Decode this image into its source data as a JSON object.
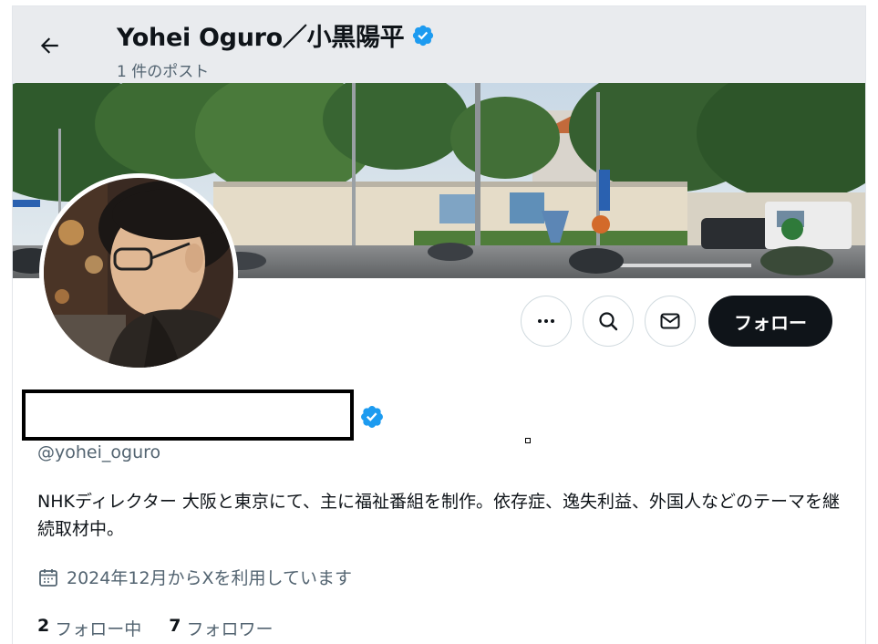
{
  "header": {
    "display_name": "Yohei Oguro／小黒陽平",
    "post_count": "1 件のポスト",
    "back_icon": "arrow-left-icon",
    "verified_icon": "verified-badge-icon"
  },
  "profile": {
    "handle": "@yohei_oguro",
    "bio": "NHKディレクター 大阪と東京にて、主に福祉番組を制作。依存症、逸失利益、外国人などのテーマを継続取材中。",
    "joined": "2024年12月からXを利用しています",
    "calendar_icon": "calendar-icon"
  },
  "actions": {
    "more_icon": "more-icon",
    "search_icon": "search-icon",
    "message_icon": "mail-icon",
    "follow_label": "フォロー"
  },
  "stats": {
    "following_count": "2",
    "following_label": "フォロー中",
    "followers_count": "7",
    "followers_label": "フォロワー"
  },
  "colors": {
    "verified": "#1d9bf0",
    "text_primary": "#0f1419",
    "text_secondary": "#536471",
    "header_bg": "#e9ebee"
  }
}
